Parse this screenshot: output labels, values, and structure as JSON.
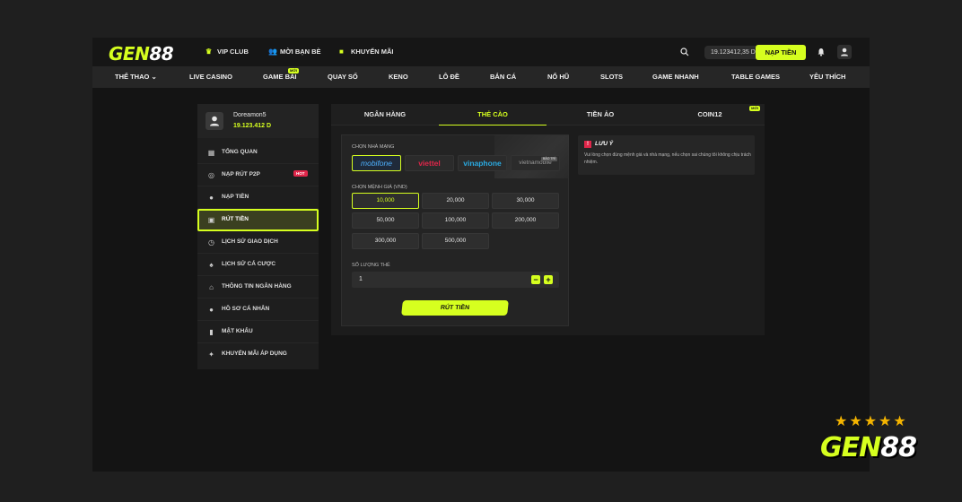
{
  "header": {
    "logo_prefix": "GEN",
    "logo_suffix": "88",
    "links": [
      {
        "label": "VIP CLUB",
        "icon": "crown-icon"
      },
      {
        "label": "MỜI BẠN BÈ",
        "icon": "users-icon"
      },
      {
        "label": "KHUYẾN MÃI",
        "icon": "gift-icon"
      }
    ],
    "balance": "19.123412,35 D",
    "deposit_label": "NẠP TIỀN"
  },
  "nav": {
    "items": [
      "THỂ THAO",
      "LIVE CASINO",
      "GAME BÀI",
      "QUAY SỐ",
      "KENO",
      "LÔ ĐỀ",
      "BẮN CÁ",
      "NỔ HŨ",
      "SLOTS",
      "GAME NHANH",
      "TABLE GAMES",
      "YÊU THÍCH"
    ],
    "new_badge": "MỚI"
  },
  "sidebar": {
    "username": "Doreamon5",
    "balance": "19.123.412 D",
    "hot_badge": "HOT",
    "items": [
      {
        "label": "TỔNG QUAN",
        "icon": "grid-icon"
      },
      {
        "label": "NẠP RÚT P2P",
        "icon": "coins-icon"
      },
      {
        "label": "NẠP TIỀN",
        "icon": "deposit-icon"
      },
      {
        "label": "RÚT TIỀN",
        "icon": "withdraw-icon"
      },
      {
        "label": "LỊCH SỬ GIAO DỊCH",
        "icon": "history-icon"
      },
      {
        "label": "LỊCH SỬ CÁ CƯỢC",
        "icon": "bet-history-icon"
      },
      {
        "label": "THÔNG TIN NGÂN HÀNG",
        "icon": "bank-icon"
      },
      {
        "label": "HỒ SƠ CÁ NHÂN",
        "icon": "profile-icon"
      },
      {
        "label": "MẬT KHẨU",
        "icon": "lock-icon"
      },
      {
        "label": "KHUYẾN MÃI ÁP DỤNG",
        "icon": "promo-icon"
      }
    ]
  },
  "tabs": [
    "NGÂN HÀNG",
    "THẺ CÀO",
    "TIỀN ẢO",
    "COIN12"
  ],
  "tab_badge": "MỚI",
  "card_form": {
    "network_label": "CHỌN NHÀ MẠNG",
    "providers": [
      "mobifone",
      "viettel",
      "vinaphone",
      "vietnamobile"
    ],
    "provider_badge": "BẢO TRÌ",
    "amount_label": "CHỌN MỆNH GIÁ (VND)",
    "amounts": [
      "10,000",
      "20,000",
      "30,000",
      "50,000",
      "100,000",
      "200,000",
      "300,000",
      "500,000"
    ],
    "quantity_label": "SỐ LƯỢNG THẺ",
    "quantity_value": "1",
    "minus": "−",
    "plus": "+",
    "submit_label": "RÚT TIỀN"
  },
  "note": {
    "icon_text": "!",
    "title": "LƯU Ý",
    "text": "Vui lòng chọn đúng mệnh giá và nhà mạng, nếu chọn sai chúng tôi không chịu trách nhiệm."
  },
  "watermark": {
    "prefix": "GEN",
    "suffix": "88",
    "stars": "★★★★★"
  },
  "colors": {
    "accent": "#d6ff1f",
    "hot": "#e0264a",
    "background": "#141414",
    "viettel": "#e0264a",
    "vinaphone": "#2aa9e0"
  }
}
